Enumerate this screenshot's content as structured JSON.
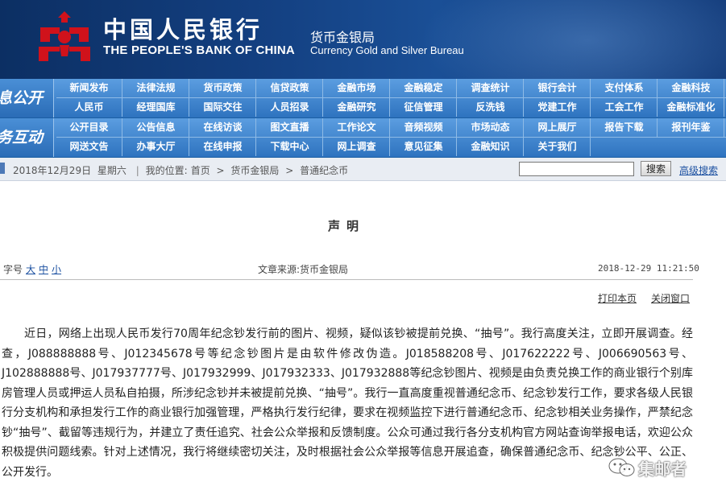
{
  "header": {
    "cn_title": "中国人民银行",
    "en_title": "THE PEOPLE'S BANK OF CHINA",
    "dept_cn": "货币金银局",
    "dept_en": "Currency  Gold and Silver Bureau",
    "logo_icon": "pboc-emblem-icon",
    "colors": {
      "banner": "#133f80",
      "logo_red": "#d0121b"
    }
  },
  "nav": {
    "group1_label": "息公开",
    "group2_label": "务互动",
    "group1_row1": [
      "新闻发布",
      "法律法规",
      "货币政策",
      "信贷政策",
      "金融市场",
      "金融稳定",
      "调查统计",
      "银行会计",
      "支付体系",
      "金融科技"
    ],
    "group1_row2": [
      "人民币",
      "经理国库",
      "国际交往",
      "人员招录",
      "金融研究",
      "征信管理",
      "反洗钱",
      "党建工作",
      "工会工作",
      "金融标准化"
    ],
    "group2_row1": [
      "公开目录",
      "公告信息",
      "在线访谈",
      "图文直播",
      "工作论文",
      "音频视频",
      "市场动态",
      "网上展厅",
      "报告下载",
      "报刊年鉴"
    ],
    "group2_row2": [
      "网送文告",
      "办事大厅",
      "在线申报",
      "下载中心",
      "网上调查",
      "意见征集",
      "金融知识",
      "关于我们"
    ]
  },
  "crumbbar": {
    "date": "2018年12月29日",
    "weekday": "星期六",
    "location_label": "我的位置:",
    "home": "首页",
    "section": "货币金银局",
    "current": "普通纪念币",
    "sep": ">",
    "search_placeholder": "",
    "search_button": "搜索",
    "advanced_search": "高级搜索"
  },
  "article": {
    "title": "声明",
    "fontsize_label": "字号",
    "fontsize_large": "大",
    "fontsize_medium": "中",
    "fontsize_small": "小",
    "source": "文章来源:货币金银局",
    "datetime": "2018-12-29  11:21:50",
    "print": "打印本页",
    "close": "关闭窗口",
    "body": "近日，网络上出现人民币发行70周年纪念钞发行前的图片、视频，疑似该钞被提前兑换、“抽号”。我行高度关注，立即开展调查。经查，J088888888号、J012345678号等纪念钞图片是由软件修改伪造。J018588208号、J017622222号、J006690563号、J102888888号、J017937777号、J017932999、J017932333、J017932888等纪念钞图片、视频是由负责兑换工作的商业银行个别库房管理人员或押运人员私自拍摄，所涉纪念钞并未被提前兑换、“抽号”。我行一直高度重视普通纪念币、纪念钞发行工作，要求各级人民银行分支机构和承担发行工作的商业银行加强管理，严格执行发行纪律，要求在视频监控下进行普通纪念币、纪念钞相关业务操作，严禁纪念钞“抽号”、截留等违规行为，并建立了责任追究、社会公众举报和反馈制度。公众可通过我行各分支机构官方网站查询举报电话，欢迎公众积极提供问题线索。针对上述情况，我行将继续密切关注，及时根据社会公众举报等信息开展追查，确保普通纪念币、纪念钞公平、公正、公开发行。"
  },
  "watermark": {
    "text": "集邮者",
    "icon": "wechat-icon"
  }
}
